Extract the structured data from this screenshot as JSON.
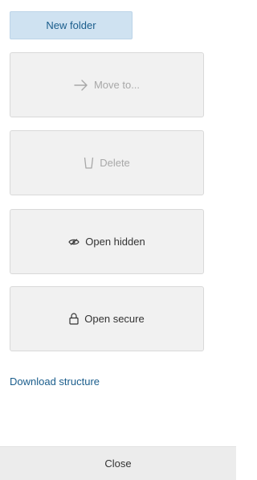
{
  "new_folder_label": "New folder",
  "actions": {
    "move": {
      "label": "Move to...",
      "icon": "arrow-right-icon",
      "disabled": true
    },
    "delete": {
      "label": "Delete",
      "icon": "trash-icon",
      "disabled": true
    },
    "open_hidden": {
      "label": "Open hidden",
      "icon": "eye-icon",
      "disabled": false
    },
    "open_secure": {
      "label": "Open secure",
      "icon": "lock-icon",
      "disabled": false
    }
  },
  "download_structure_label": "Download structure",
  "close_label": "Close",
  "colors": {
    "primary_button_bg": "#cfe2f1",
    "link": "#1a5d8c",
    "disabled_text": "#a8a8a8",
    "button_bg": "#f1f1f1",
    "close_bar_bg": "#ececec"
  }
}
